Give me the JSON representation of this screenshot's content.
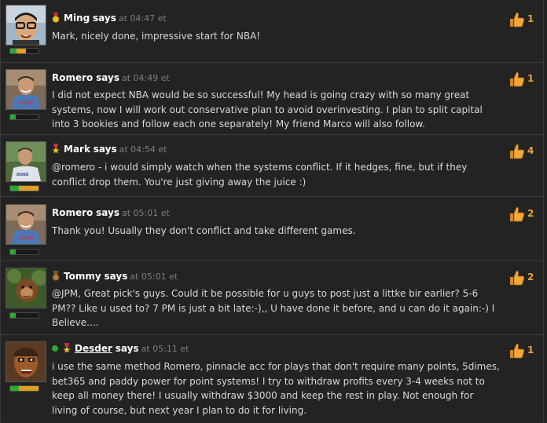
{
  "comments": [
    {
      "author": "Ming",
      "says": "says",
      "time": "at 04:47 et",
      "text": "Mark, nicely done, impressive start for NBA!",
      "likes": "1",
      "medal": "gold-medal",
      "rank_level": 0.55,
      "rank_color": "#e0a020",
      "avatar": "ming"
    },
    {
      "author": "Romero",
      "says": "says",
      "time": "at 04:49 et",
      "text": "I did not expect NBA would be so successful! My head is going crazy with so many great systems, now I will work out conservative plan to avoid overinvesting. I plan to split capital into 3 bookies and follow each one separately! My friend Marco will also follow.",
      "likes": "1",
      "medal": "",
      "rank_level": 0.2,
      "rank_color": "#2ea82e",
      "avatar": "romero"
    },
    {
      "author": "Mark",
      "says": "says",
      "time": "at 04:54 et",
      "text": "@romero - i would simply watch when the systems conflict. If it hedges, fine, but if they conflict drop them. You're just giving away the juice :)",
      "likes": "4",
      "medal": "star-medal",
      "rank_level": 1.0,
      "rank_color": "#e0a020",
      "avatar": "mark"
    },
    {
      "author": "Romero",
      "says": "says",
      "time": "at 05:01 et",
      "text": "Thank you! Usually they don't conflict and take different games.",
      "likes": "2",
      "medal": "",
      "rank_level": 0.2,
      "rank_color": "#2ea82e",
      "avatar": "romero"
    },
    {
      "author": "Tommy",
      "says": "says",
      "time": "at 05:01 et",
      "text": "@JPM, Great pick's guys. Could it be possible for u guys to post just a littke bir earlier? 5-6 PM?? Like u used to? 7 PM is just a bit late:-),, U have done it before, and u can do it again:-) I Believe....",
      "likes": "2",
      "medal": "bronze-medal",
      "rank_level": 0.2,
      "rank_color": "#2ea82e",
      "avatar": "tommy"
    },
    {
      "author": "Desder",
      "says": "says",
      "time": "at 05:11 et",
      "text": "i use the same method Romero, pinnacle acc for plays that don't require many points, 5dimes, bet365 and paddy power for point systems! I try to withdraw profits every 3-4 weeks not to keep all money there! I usually withdraw $3000 and keep the rest in play. Not enough for living of course, but next year I plan to do it for living.",
      "likes": "1",
      "medal": "star-medal",
      "rank_level": 1.0,
      "rank_color": "#e0a020",
      "avatar": "desder",
      "online": true
    }
  ]
}
